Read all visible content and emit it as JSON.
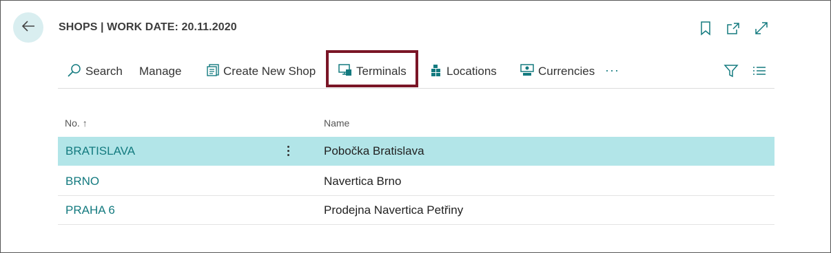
{
  "header": {
    "title": "SHOPS | WORK DATE: 20.11.2020",
    "back_icon": "arrow-left-icon",
    "bookmark_icon": "bookmark-icon",
    "open_new_window_icon": "open-in-new-window-icon",
    "expand_icon": "expand-icon"
  },
  "actions": {
    "search": "Search",
    "manage": "Manage",
    "create_new_shop": "Create New Shop",
    "terminals": "Terminals",
    "locations": "Locations",
    "currencies": "Currencies",
    "more": "···"
  },
  "columns": {
    "no": "No.",
    "sort_indicator": "↑",
    "name": "Name"
  },
  "rows": [
    {
      "no": "BRATISLAVA",
      "name": "Pobočka Bratislava",
      "selected": true
    },
    {
      "no": "BRNO",
      "name": "Navertica Brno",
      "selected": false
    },
    {
      "no": "PRAHA 6",
      "name": "Prodejna Navertica Petřiny",
      "selected": false
    }
  ],
  "colors": {
    "accent": "#137a7f",
    "selected_row": "#b2e5e8",
    "highlight_border": "#7a1526",
    "back_button_bg": "#d9eef0"
  }
}
